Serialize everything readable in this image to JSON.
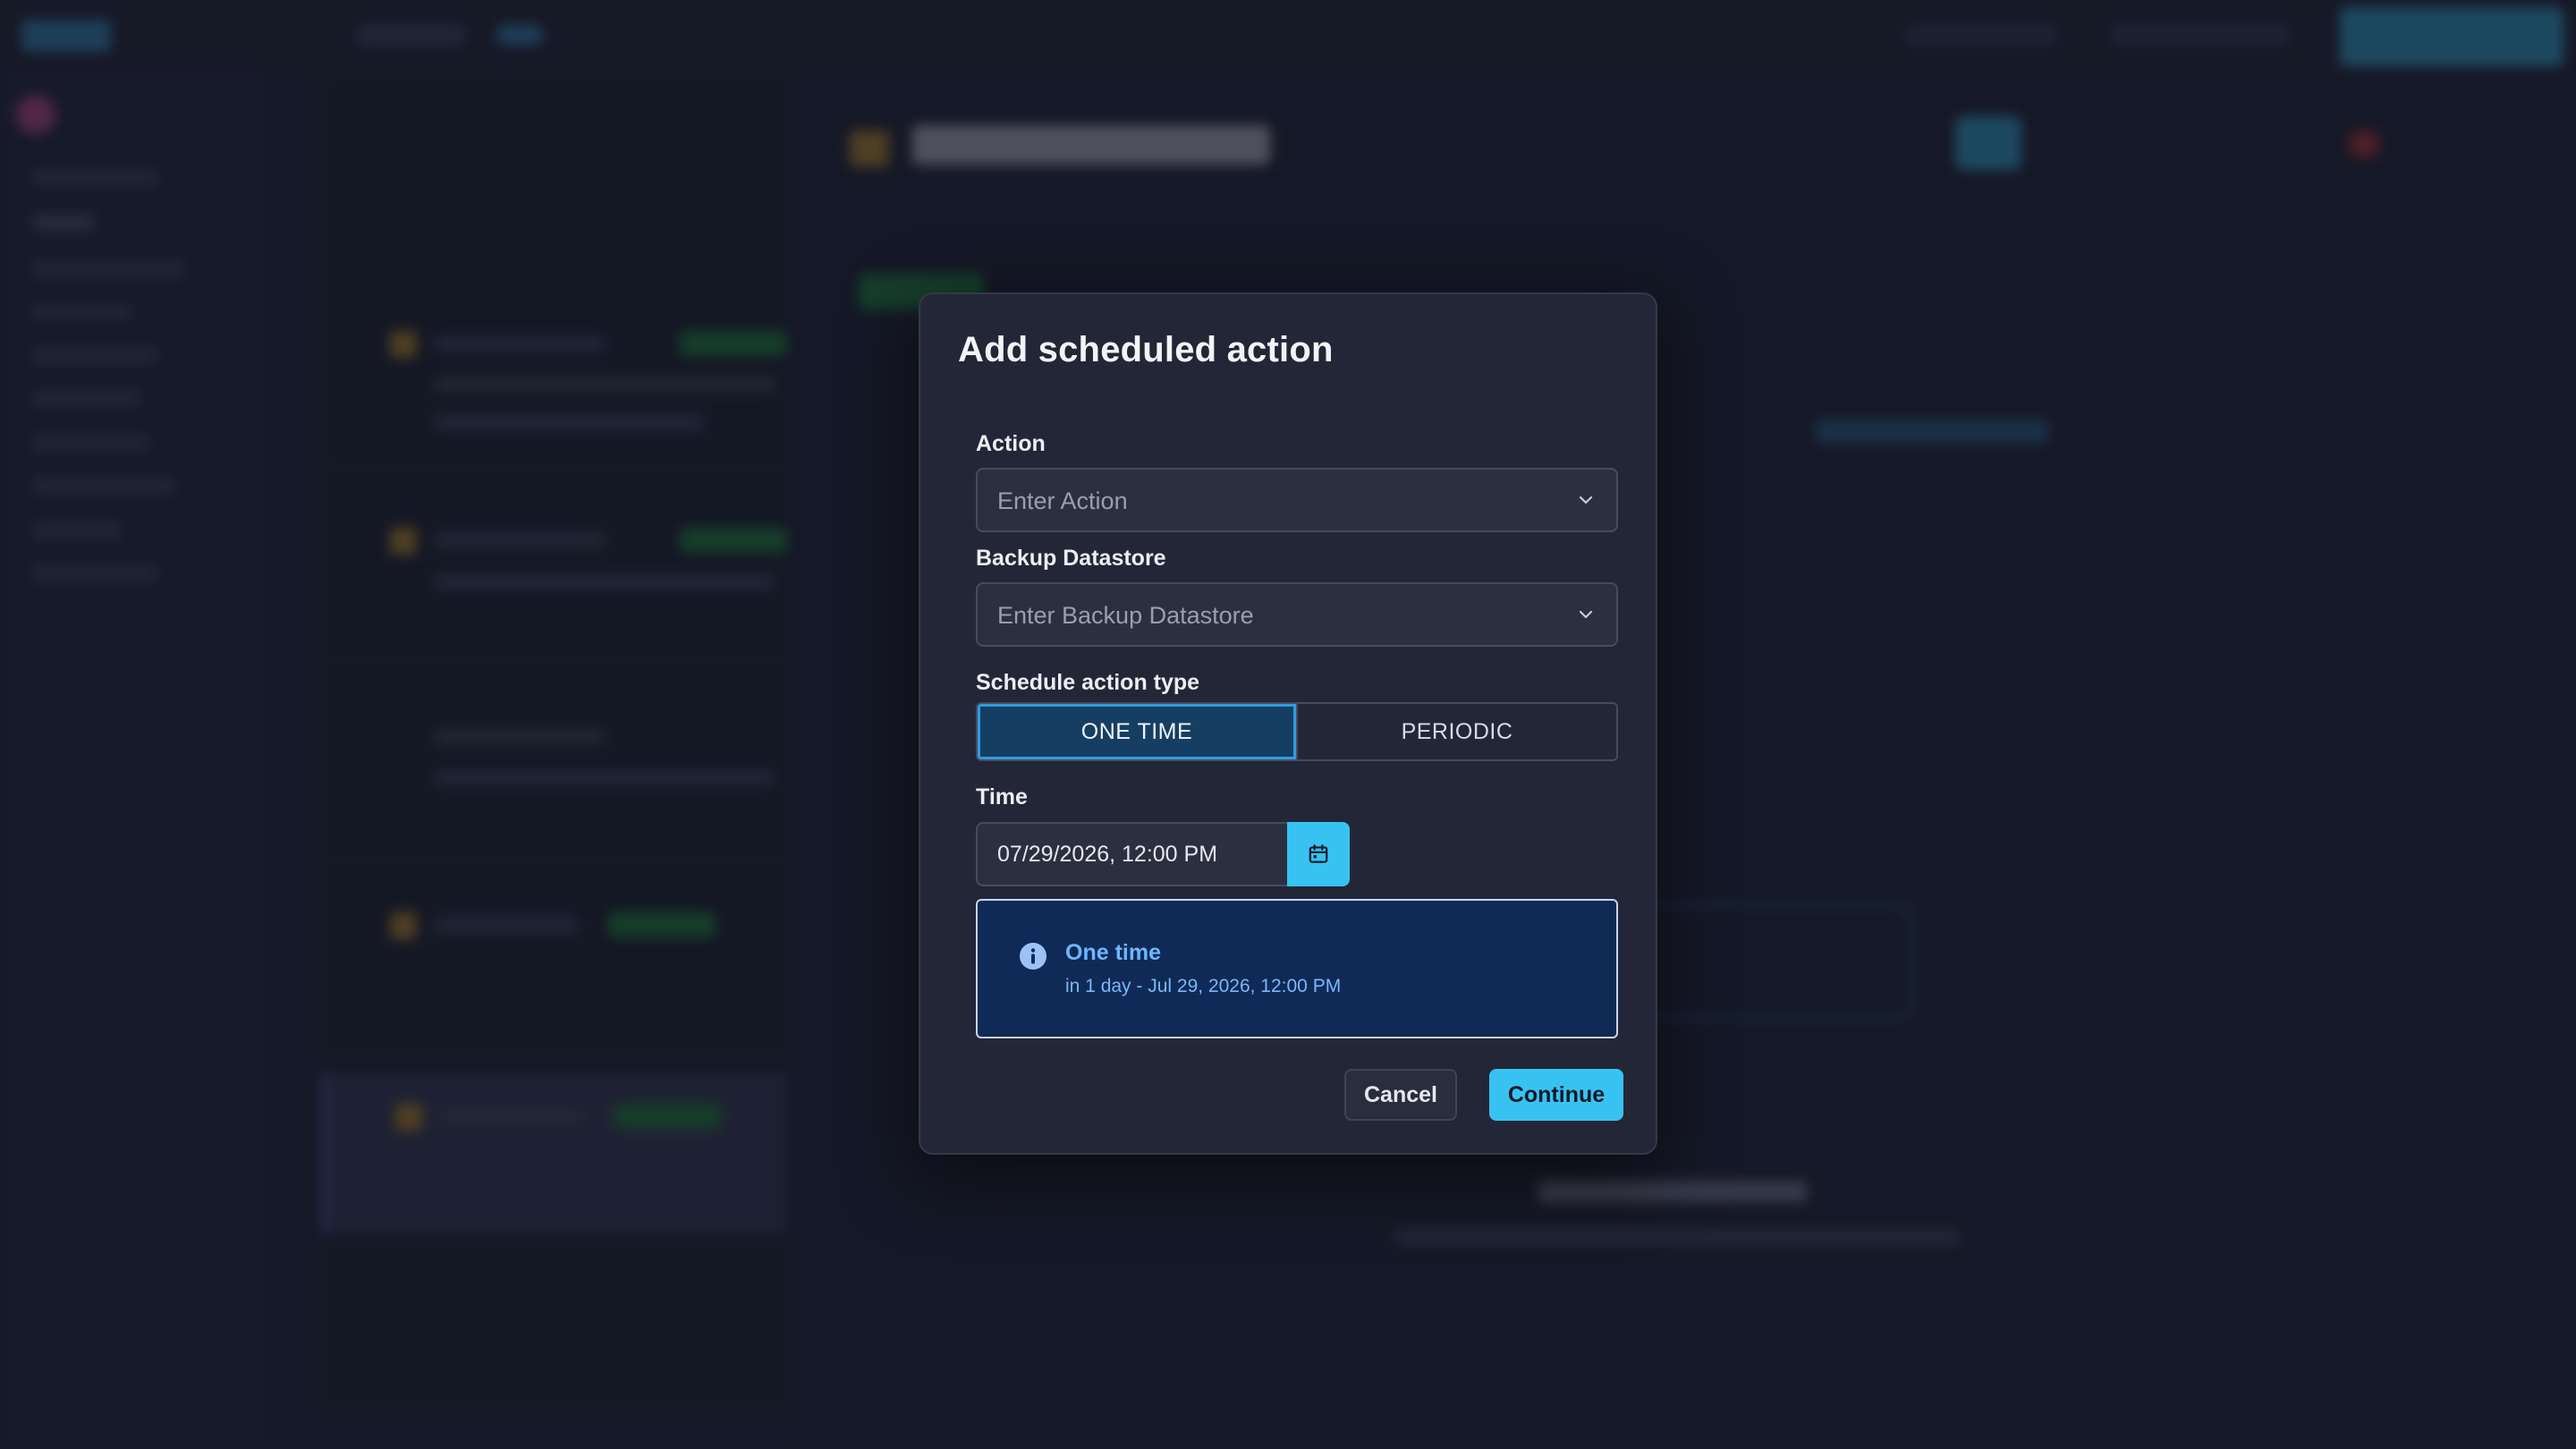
{
  "modal": {
    "title": "Add scheduled action",
    "action": {
      "label": "Action",
      "placeholder": "Enter Action",
      "chevron_icon": "chevron-down-icon"
    },
    "backup_datastore": {
      "label": "Backup Datastore",
      "placeholder": "Enter Backup Datastore",
      "chevron_icon": "chevron-down-icon"
    },
    "schedule_type": {
      "label": "Schedule action type",
      "options": [
        "ONE TIME",
        "PERIODIC"
      ],
      "selected": "ONE TIME"
    },
    "time": {
      "label": "Time",
      "value": "07/29/2026, 12:00 PM",
      "calendar_icon": "calendar-icon"
    },
    "info": {
      "icon": "info-icon",
      "title": "One time",
      "subtitle": "in 1 day - Jul 29, 2026, 12:00 PM"
    },
    "buttons": {
      "cancel": "Cancel",
      "continue": "Continue"
    }
  },
  "colors": {
    "accent": "#38c2f2",
    "modal_bg": "#232636",
    "info_bg": "#0f2a56",
    "info_text": "#6fb6ff",
    "toggle_active_border": "#2f9ce0"
  }
}
